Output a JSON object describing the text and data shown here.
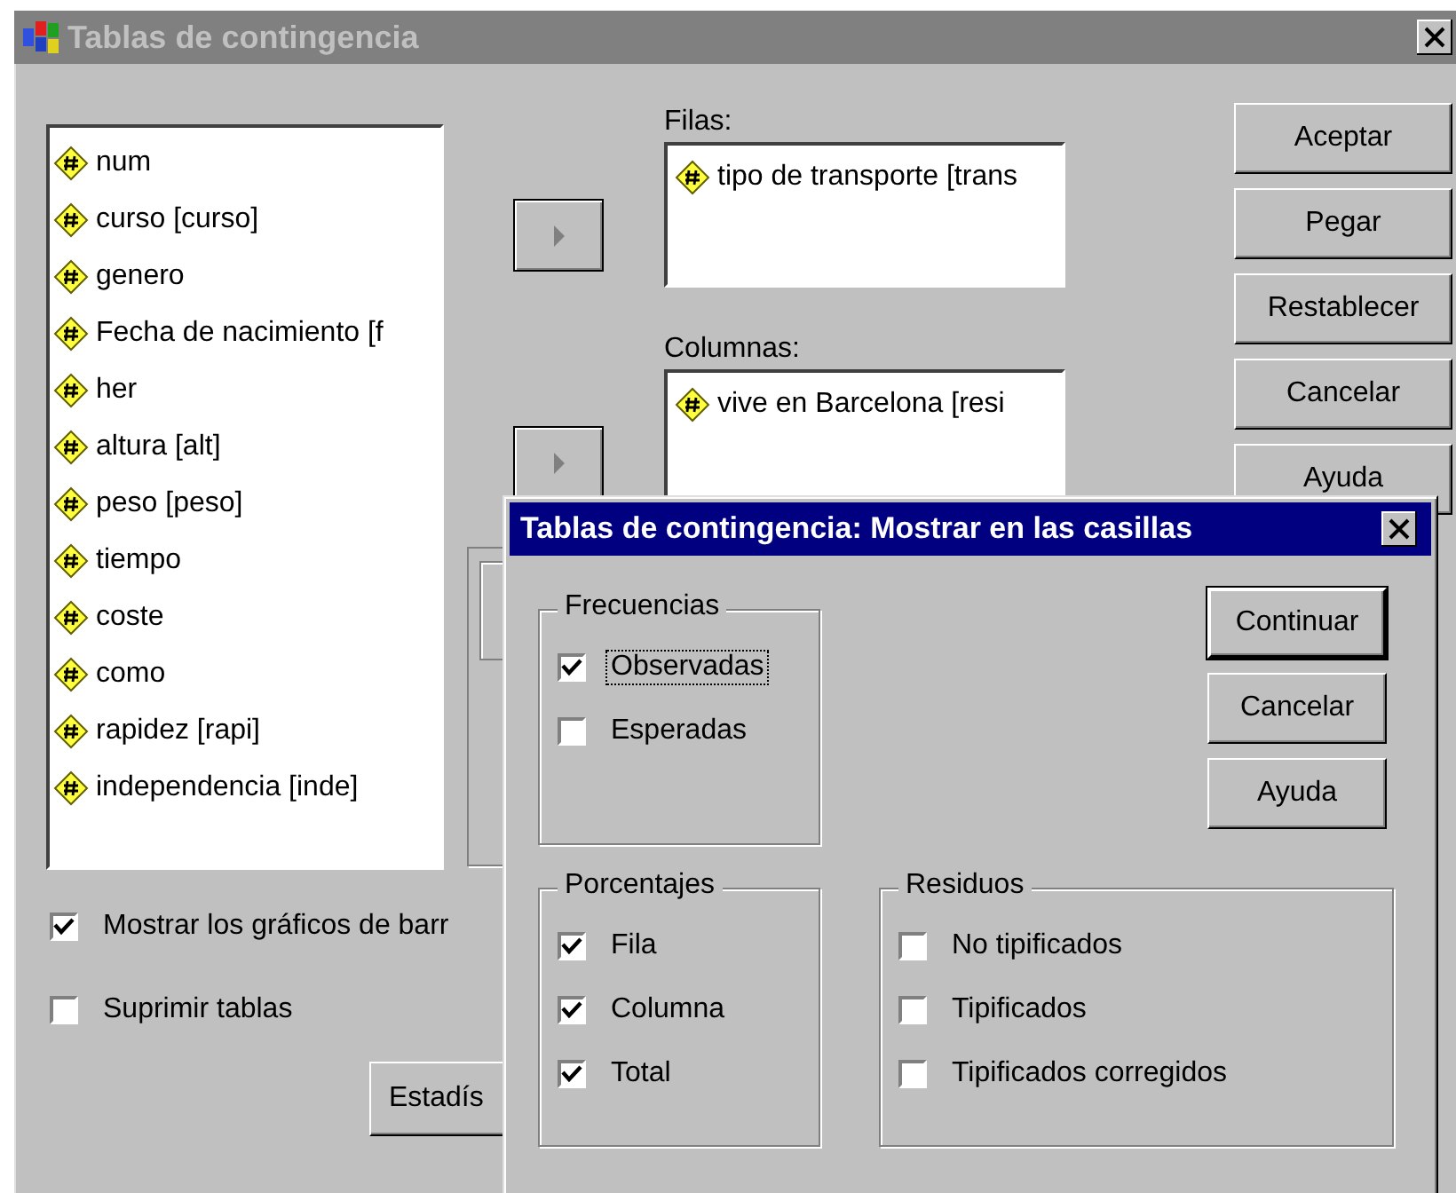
{
  "window": {
    "title": "Tablas de contingencia"
  },
  "variables": [
    {
      "name": "num"
    },
    {
      "name": "curso [curso]"
    },
    {
      "name": "genero"
    },
    {
      "name": "Fecha de nacimiento [f"
    },
    {
      "name": "her"
    },
    {
      "name": "altura [alt]"
    },
    {
      "name": "peso [peso]"
    },
    {
      "name": "tiempo"
    },
    {
      "name": "coste"
    },
    {
      "name": "como"
    },
    {
      "name": "rapidez [rapi]"
    },
    {
      "name": "independencia [inde]"
    }
  ],
  "filas": {
    "label": "Filas:",
    "items": [
      {
        "name": "tipo de transporte [trans"
      }
    ]
  },
  "columnas": {
    "label": "Columnas:",
    "items": [
      {
        "name": "vive en Barcelona [resi"
      }
    ]
  },
  "buttons": [
    "Aceptar",
    "Pegar",
    "Restablecer",
    "Cancelar",
    "Ayuda"
  ],
  "options": [
    {
      "label": "Mostrar los gráficos de barr",
      "checked": true
    },
    {
      "label": "Suprimir tablas",
      "checked": false
    }
  ],
  "statistics_button": "Estadís",
  "cells_dialog": {
    "title": "Tablas de contingencia: Mostrar en las casillas",
    "groups": [
      {
        "title": "Frecuencias",
        "options": [
          {
            "label": "Observadas",
            "checked": true,
            "focused": true
          },
          {
            "label": "Esperadas",
            "checked": false,
            "focused": false
          }
        ]
      },
      {
        "title": "Porcentajes",
        "options": [
          {
            "label": "Fila",
            "checked": true,
            "focused": false
          },
          {
            "label": "Columna",
            "checked": true,
            "focused": false
          },
          {
            "label": "Total",
            "checked": true,
            "focused": false
          }
        ]
      },
      {
        "title": "Residuos",
        "options": [
          {
            "label": "No tipificados",
            "checked": false,
            "focused": false
          },
          {
            "label": "Tipificados",
            "checked": false,
            "focused": false
          },
          {
            "label": "Tipificados corregidos",
            "checked": false,
            "focused": false
          }
        ]
      }
    ],
    "buttons": [
      {
        "label": "Continuar",
        "default": true
      },
      {
        "label": "Cancelar",
        "default": false
      },
      {
        "label": "Ayuda",
        "default": false
      }
    ]
  }
}
